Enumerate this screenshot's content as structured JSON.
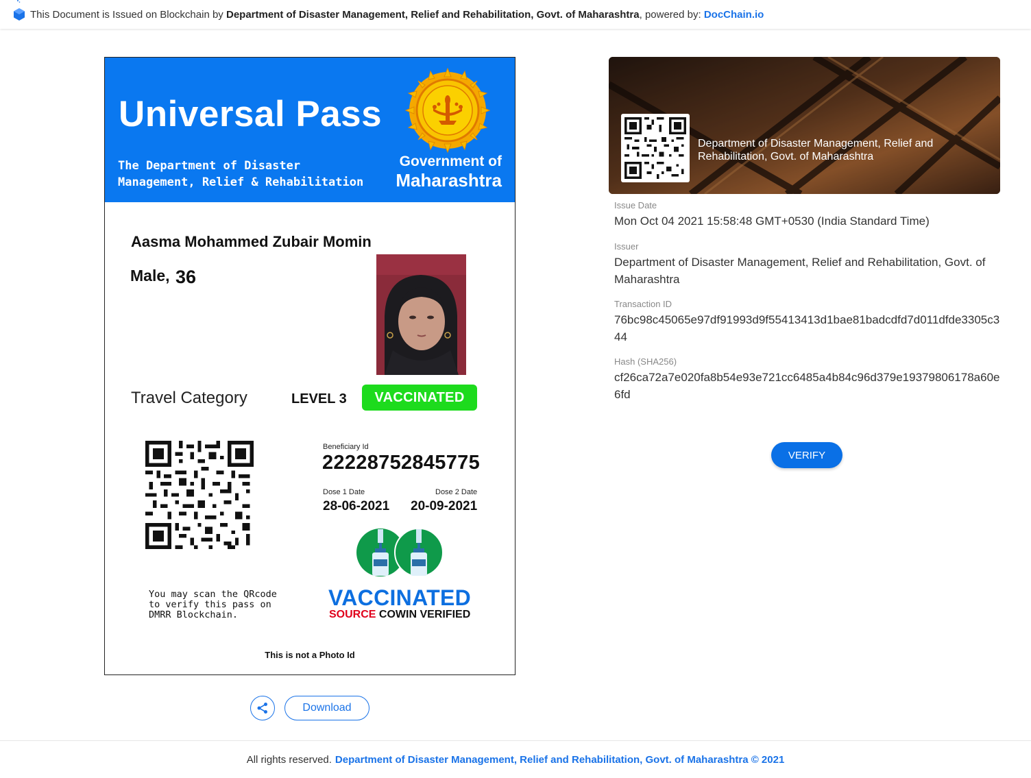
{
  "banner": {
    "prefix": "This Document is Issued on Blockchain by",
    "issuer": "Department of Disaster Management, Relief and Rehabilitation, Govt. of Maharashtra",
    "powered_by": ", powered by:",
    "provider": "DocChain.io"
  },
  "certificate": {
    "title": "Universal Pass",
    "dept_line1": "The Department of Disaster",
    "dept_line2": "Management, Relief & Rehabilitation",
    "gov_line1": "Government of",
    "gov_line2": "Maharashtra",
    "name": "Aasma Mohammed Zubair Momin",
    "gender": "Male,",
    "age": "36",
    "travel_category_label": "Travel Category",
    "level": "LEVEL 3",
    "status_badge": "VACCINATED",
    "beneficiary_label": "Beneficiary Id",
    "beneficiary_id": "22228752845775",
    "dose1_label": "Dose 1 Date",
    "dose2_label": "Dose 2 Date",
    "dose1_date": "28-06-2021",
    "dose2_date": "20-09-2021",
    "scan_text": "You may scan the QRcode\nto  verify this pass on\nDMRR Blockchain.",
    "vaccinated_big": "VACCINATED",
    "source_word": "SOURCE",
    "source_rest": "COWIN VERIFIED",
    "not_photo_id": "This is not a Photo Id"
  },
  "actions": {
    "download_label": "Download",
    "verify_label": "VERIFY"
  },
  "issuer_card": {
    "issuer_text": "Department of Disaster Management, Relief and Rehabilitation, Govt. of Maharashtra"
  },
  "metadata": [
    {
      "label": "Issue Date",
      "value": "Mon Oct 04 2021 15:58:48 GMT+0530 (India Standard Time)"
    },
    {
      "label": "Issuer",
      "value": "Department of Disaster Management, Relief and Rehabilitation, Govt. of Maharashtra"
    },
    {
      "label": "Transaction ID",
      "value": "76bc98c45065e97df91993d9f55413413d1bae81badcdfd7d011dfde3305c344"
    },
    {
      "label": "Hash (SHA256)",
      "value": "cf26ca72a7e020fa8b54e93e721cc6485a4b84c96d379e19379806178a60e6fd"
    }
  ],
  "footer": {
    "prefix": "All rights reserved.",
    "link": "Department of Disaster Management, Relief and Rehabilitation, Govt. of Maharashtra © 2021"
  },
  "colors": {
    "header_blue": "#0a78f0",
    "vaccinated_green": "#1ddb1d",
    "link_blue": "#1a73e8",
    "source_red": "#e0001b"
  }
}
